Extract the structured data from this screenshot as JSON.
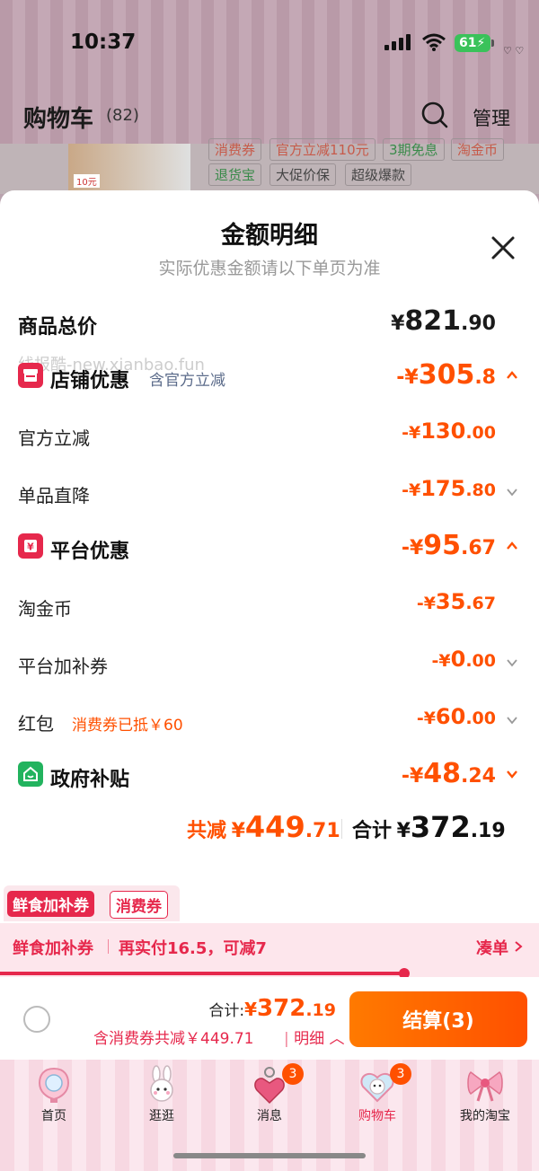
{
  "status_bar": {
    "time": "10:37",
    "battery": "61"
  },
  "header": {
    "title": "购物车",
    "count": "(82)",
    "manage_label": "管理"
  },
  "background_product": {
    "tags": [
      "消费券",
      "官方立减110元",
      "3期免息",
      "淘金币",
      "退货宝",
      "大促价保",
      "超级爆款"
    ],
    "thumb_price": "10元"
  },
  "sheet": {
    "title": "金额明细",
    "subtitle": "实际优惠金额请以下单页为准",
    "watermark": "线报酷-new.xianbao.fun",
    "rows": {
      "total_price": {
        "label": "商品总价",
        "cur": "¥",
        "int": "821",
        "dec": ".90"
      },
      "store_discount": {
        "label": "店铺优惠",
        "note": "含官方立减",
        "cur": "-¥",
        "int": "305",
        "dec": ".8"
      },
      "official_cut": {
        "label": "官方立减",
        "cur": "-¥",
        "int": "130",
        "dec": ".00"
      },
      "single_cut": {
        "label": "单品直降",
        "cur": "-¥",
        "int": "175",
        "dec": ".80"
      },
      "platform_discount": {
        "label": "平台优惠",
        "cur": "-¥",
        "int": "95",
        "dec": ".67"
      },
      "taojinbi": {
        "label": "淘金币",
        "cur": "-¥",
        "int": "35",
        "dec": ".67"
      },
      "platform_coupon": {
        "label": "平台加补券",
        "cur": "-¥",
        "int": "0",
        "dec": ".00"
      },
      "red_packet": {
        "label": "红包",
        "note": "消费券已抵￥60",
        "cur": "-¥",
        "int": "60",
        "dec": ".00"
      },
      "gov_subsidy": {
        "label": "政府补贴",
        "cur": "-¥",
        "int": "48",
        "dec": ".24"
      }
    },
    "totals": {
      "reduce_label": "共减",
      "reduce_cur": "¥",
      "reduce_int": "449",
      "reduce_dec": ".71",
      "total_label": "合计",
      "total_cur": "¥",
      "total_int": "372",
      "total_dec": ".19"
    }
  },
  "coupons": {
    "tag1": "鲜食加补券",
    "tag2": "消费券"
  },
  "promo": {
    "left": "鲜食加补券",
    "middle": "再实付16.5，可减7",
    "right": "凑单"
  },
  "progress": {
    "fraction": 0.75
  },
  "checkout": {
    "total_label": "合计:",
    "cur": "¥",
    "int": "372",
    "dec": ".19",
    "sub": "含消费券共减￥449.71",
    "detail": "明细",
    "pay_label": "结算(3)"
  },
  "tabs": [
    {
      "label": "首页",
      "icon": "mirror-icon"
    },
    {
      "label": "逛逛",
      "icon": "bunny-icon"
    },
    {
      "label": "消息",
      "icon": "heart-charm-icon",
      "badge": "3"
    },
    {
      "label": "购物车",
      "icon": "cart-heart-icon",
      "badge": "3",
      "active": true
    },
    {
      "label": "我的淘宝",
      "icon": "bow-icon"
    }
  ],
  "colors": {
    "accent": "#ff5000",
    "pink": "#e6284c",
    "green": "#22b35e"
  }
}
